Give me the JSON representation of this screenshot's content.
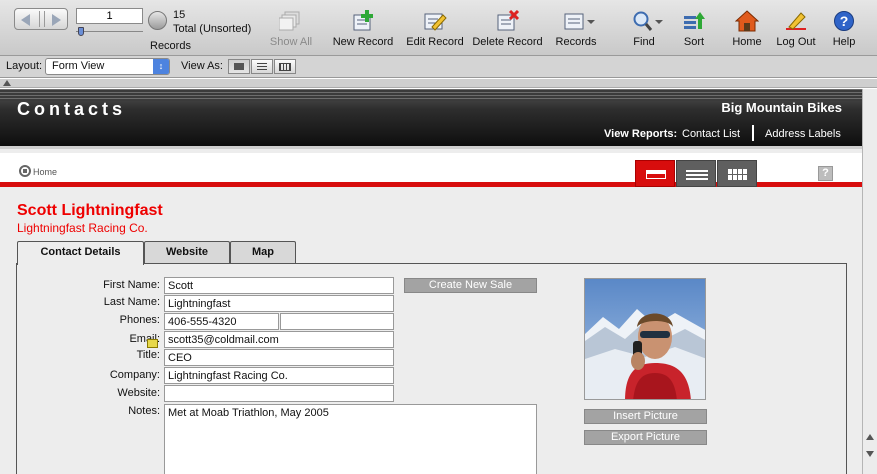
{
  "toolbar": {
    "record_number": "1",
    "record_count": "15",
    "sort_status": "Total (Unsorted)",
    "records_label": "Records",
    "buttons": {
      "show_all": "Show All",
      "new_record": "New Record",
      "edit_record": "Edit Record",
      "delete_record": "Delete Record",
      "records": "Records",
      "find": "Find",
      "sort": "Sort",
      "home": "Home",
      "log_out": "Log Out",
      "help": "Help"
    }
  },
  "layout_bar": {
    "layout_label": "Layout:",
    "layout_value": "Form View",
    "view_as_label": "View As:"
  },
  "header": {
    "title": "Contacts",
    "company": "Big Mountain Bikes",
    "view_reports_label": "View Reports:",
    "reports": [
      "Contact List",
      "Address Labels"
    ]
  },
  "nav": {
    "home_label": "Home",
    "help_glyph": "?"
  },
  "contact": {
    "name": "Scott Lightningfast",
    "company": "Lightningfast Racing Co."
  },
  "tabs": [
    "Contact Details",
    "Website",
    "Map"
  ],
  "form": {
    "labels": {
      "first_name": "First Name:",
      "last_name": "Last Name:",
      "phones": "Phones:",
      "email": "Email:",
      "title": "Title:",
      "company": "Company:",
      "website": "Website:",
      "notes": "Notes:"
    },
    "values": {
      "first_name": "Scott",
      "last_name": "Lightningfast",
      "phone1": "406-555-4320",
      "phone2": "",
      "email": "scott35@coldmail.com",
      "title": "CEO",
      "company": "Lightningfast Racing Co.",
      "website": "",
      "notes": "Met at Moab Triathlon, May 2005"
    }
  },
  "buttons": {
    "create_new_sale": "Create New Sale",
    "insert_picture": "Insert Picture",
    "export_picture": "Export Picture"
  },
  "colors": {
    "accent_red": "#d80d0d",
    "name_red": "#e00000",
    "header_dark": "#111111"
  }
}
